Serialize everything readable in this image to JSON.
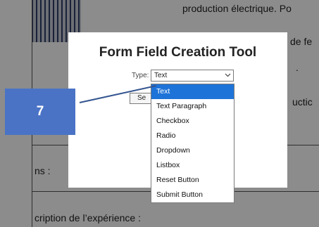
{
  "background_document": {
    "line1": "production électrique. Po",
    "line2": "de fe",
    "line3": ".",
    "line4": "uctic",
    "line5": "ns :",
    "line6": "cription de l’expérience :"
  },
  "dialog": {
    "title": "Form Field Creation Tool",
    "type_label": "Type:",
    "selected_type": "Text",
    "select_button_label": "Se",
    "arrow_icon": "chevron-down-icon"
  },
  "dropdown": {
    "options": [
      "Text",
      "Text Paragraph",
      "Checkbox",
      "Radio",
      "Dropdown",
      "Listbox",
      "Reset Button",
      "Submit Button"
    ],
    "selected_index": 0
  },
  "annotation": {
    "step_number": "7"
  },
  "colors": {
    "badge": "#4a73c6",
    "selection": "#1e73d8",
    "overlay": "rgba(0,0,0,0.45)"
  }
}
